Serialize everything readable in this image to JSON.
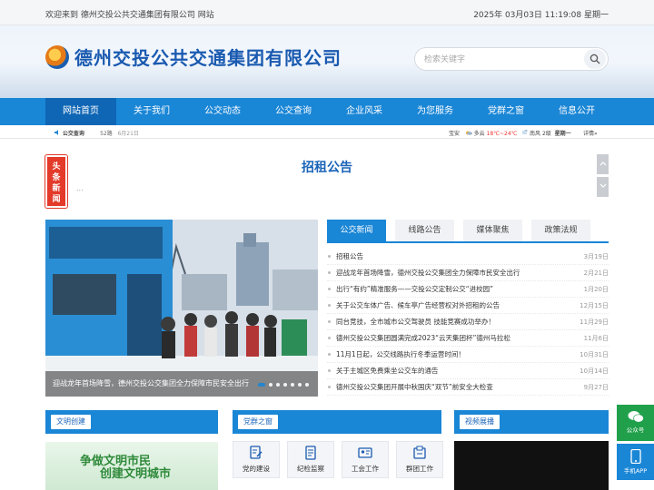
{
  "topbar": {
    "welcome": "欢迎来到 德州交投公共交通集团有限公司 网站",
    "datetime": "2025年 03月03日  11:19:08  星期一"
  },
  "header": {
    "logo_text": "德州交投公共交通集团有限公司",
    "search_placeholder": "检索关键字"
  },
  "nav": {
    "items": [
      "网站首页",
      "关于我们",
      "公交动态",
      "公交查询",
      "企业风采",
      "为您服务",
      "党群之窗",
      "信息公开"
    ],
    "active": "网站首页"
  },
  "weather": {
    "left_label": "公交查询",
    "left_route": "52路",
    "left_time": "6月21日",
    "city": "宝安",
    "condition": "多云",
    "temp": "18℃~24℃",
    "wind": "南风 2级",
    "weekday": "星期一",
    "detail": "详情»"
  },
  "headline": {
    "tag": "头条新闻",
    "title": "招租公告",
    "summary": "..."
  },
  "slider": {
    "caption": "迎战龙年首场降雪，德州交投公交集团全力保障市民安全出行"
  },
  "news": {
    "tabs": [
      "公交新闻",
      "线路公告",
      "媒体聚焦",
      "政策法规"
    ],
    "active_tab": "公交新闻",
    "items": [
      {
        "title": "招租公告",
        "date": "3月19日"
      },
      {
        "title": "迎战龙年首场降雪，德州交投公交集团全力保障市民安全出行",
        "date": "2月21日"
      },
      {
        "title": "出行“有约”精准服务——交投公交定制公交“进校园”",
        "date": "1月20日"
      },
      {
        "title": "关于公交车体广告、候车亭广告经营权对外招租的公告",
        "date": "12月15日"
      },
      {
        "title": "同台竞技，全市城市公交驾驶员 技能竞赛成功举办！",
        "date": "11月29日"
      },
      {
        "title": "德州交投公交集团圆满完成2023“云天集团杯”德州马拉松",
        "date": "11月6日"
      },
      {
        "title": "11月1日起，公交线路执行冬季运营时间！",
        "date": "10月31日"
      },
      {
        "title": "关于主城区免费乘坐公交车的通告",
        "date": "10月14日"
      },
      {
        "title": "德州交投公交集团开展中秋国庆“双节”前安全大检查",
        "date": "9月27日"
      }
    ]
  },
  "panels": {
    "wenming": "文明创建",
    "dangqun": "党群之窗",
    "video": "视频展播",
    "wenming_banner_line1": "争做文明市民",
    "wenming_banner_line2": "创建文明城市",
    "tiles": [
      "党的建设",
      "纪检监察",
      "工会工作",
      "群团工作"
    ]
  },
  "side": {
    "wechat": "公众号",
    "app": "手机APP"
  },
  "colors": {
    "primary": "#1a86d6",
    "nav_active": "#0f66b5",
    "tag_red": "#e33a2a",
    "title_blue": "#1a64b8",
    "side_green": "#20a04a"
  }
}
